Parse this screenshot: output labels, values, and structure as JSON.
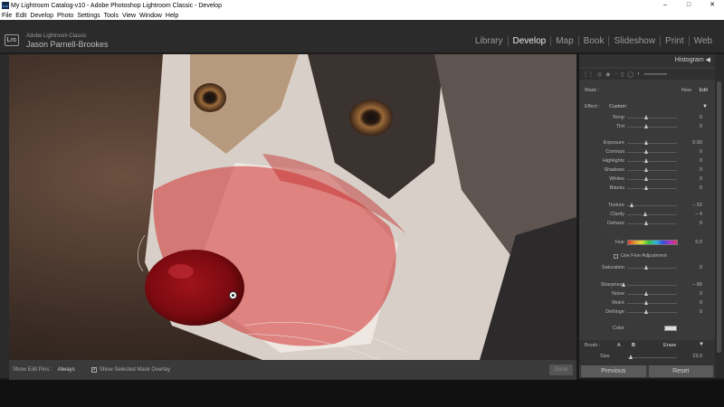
{
  "window": {
    "title": "My Lightroom Catalog-v10 - Adobe Photoshop Lightroom Classic - Develop",
    "app_icon": "Lrc",
    "controls": [
      "–",
      "□",
      "✕"
    ]
  },
  "menu": [
    "File",
    "Edit",
    "Develop",
    "Photo",
    "Settings",
    "Tools",
    "View",
    "Window",
    "Help"
  ],
  "identity": {
    "logo": "Lrc",
    "product": "Adobe Lightroom Classic",
    "user": "Jason Parnell-Brookes"
  },
  "modules": [
    {
      "label": "Library",
      "active": false
    },
    {
      "label": "Develop",
      "active": true
    },
    {
      "label": "Map",
      "active": false
    },
    {
      "label": "Book",
      "active": false
    },
    {
      "label": "Slideshow",
      "active": false
    },
    {
      "label": "Print",
      "active": false
    },
    {
      "label": "Web",
      "active": false
    }
  ],
  "toolbar": {
    "show_pins_label": "Show Edit Pins :",
    "show_pins_value": "Always",
    "overlay_label": "Show Selected Mask Overlay",
    "overlay_checked": "✓",
    "done": "Done"
  },
  "panel": {
    "histogram": "Histogram",
    "histogram_arrow": "◀",
    "mask_label": "Mask :",
    "mask_new": "New",
    "mask_edit": "Edit",
    "effect_label": "Effect :",
    "effect_value": "Custom",
    "effect_arrow": "▼",
    "sliders": [
      {
        "label": "Temp",
        "value": "0"
      },
      {
        "label": "Tint",
        "value": "0"
      },
      {
        "label": "Exposure",
        "value": "0.00"
      },
      {
        "label": "Contrast",
        "value": "0"
      },
      {
        "label": "Highlights",
        "value": "0"
      },
      {
        "label": "Shadows",
        "value": "0"
      },
      {
        "label": "Whites",
        "value": "0"
      },
      {
        "label": "Blacks",
        "value": "0"
      },
      {
        "label": "Texture",
        "value": "– 52"
      },
      {
        "label": "Clarity",
        "value": "– 4"
      },
      {
        "label": "Dehaze",
        "value": "0"
      },
      {
        "label": "Saturation",
        "value": "0"
      },
      {
        "label": "Sharpness",
        "value": "– 80"
      },
      {
        "label": "Noise",
        "value": "0"
      },
      {
        "label": "Moiré",
        "value": "0"
      },
      {
        "label": "Defringe",
        "value": "0"
      }
    ],
    "hue_label": "Hue",
    "hue_value": "0.0",
    "fine_adjust": "Use Fine Adjustment",
    "color_label": "Color",
    "brush_label": "Brush :",
    "brush_a": "A",
    "brush_b": "B",
    "brush_erase": "Erase",
    "brush_arrow": "▼",
    "size_label": "Size",
    "size_value": "23.0",
    "previous": "Previous",
    "reset": "Reset"
  }
}
